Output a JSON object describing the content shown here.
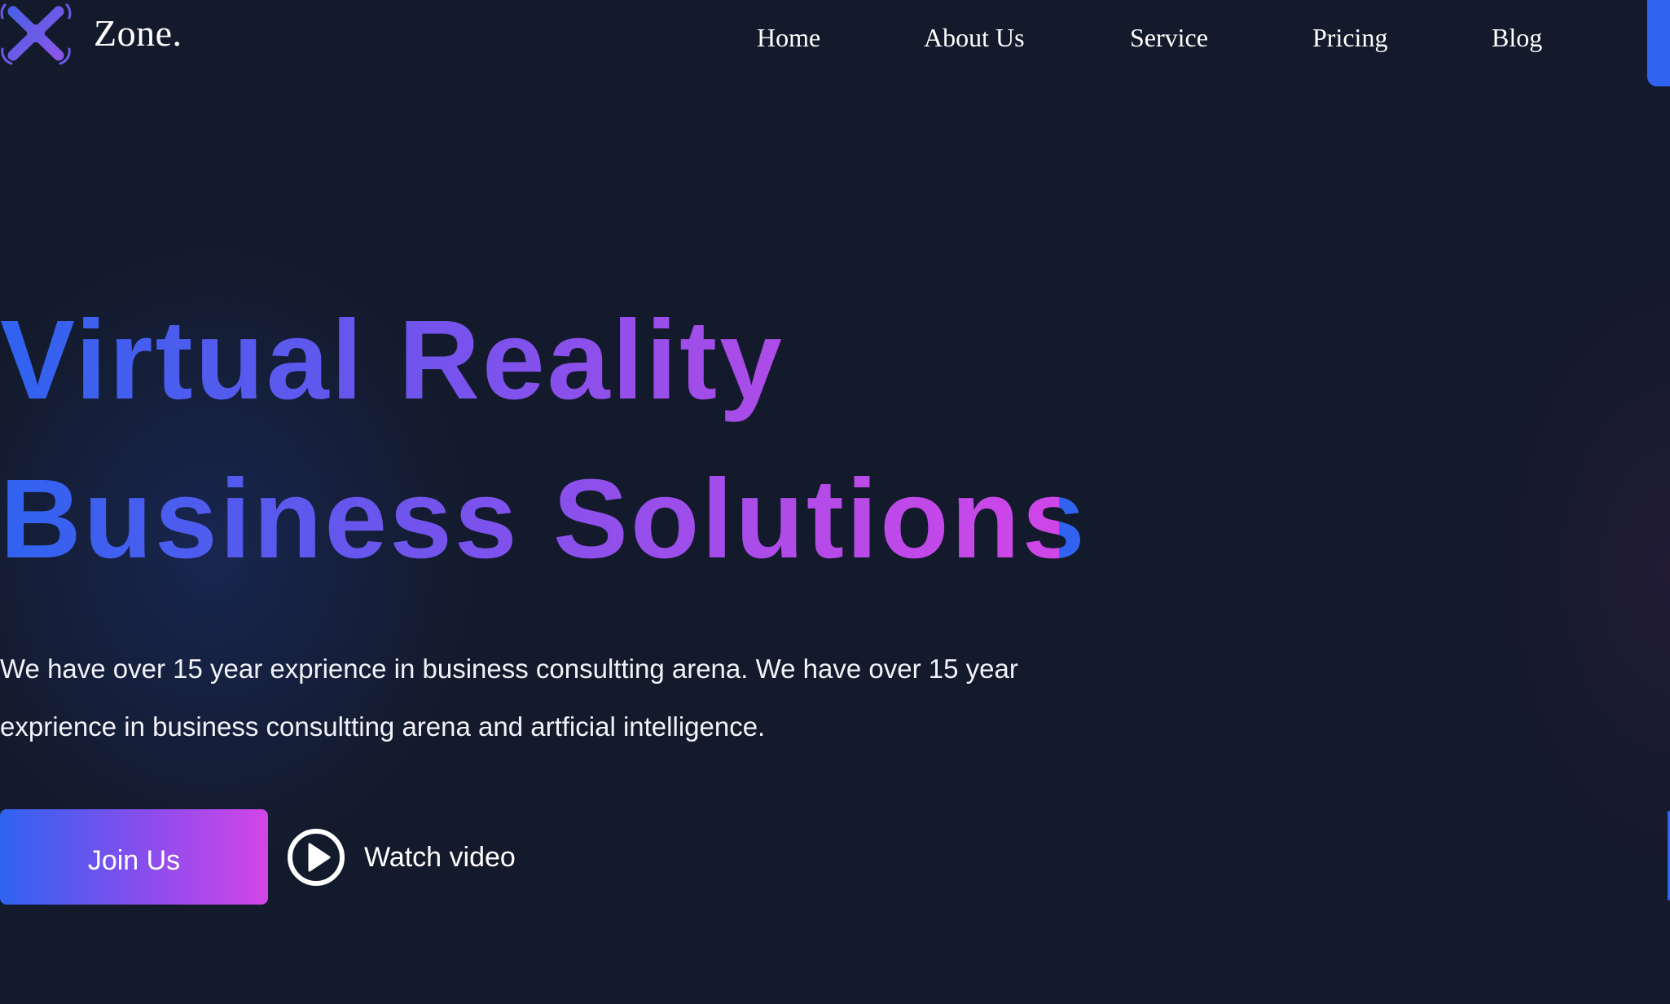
{
  "brand": {
    "name": "Zone.",
    "logo_icon": "drone-icon"
  },
  "nav": {
    "items": [
      {
        "label": "Home"
      },
      {
        "label": "About Us"
      },
      {
        "label": "Service"
      },
      {
        "label": "Pricing"
      },
      {
        "label": "Blog"
      }
    ]
  },
  "hero": {
    "headline_line1": "Virtual Reality",
    "headline_line2": "Business Solutions",
    "description": "We have over 15 year exprience in business consultting arena. We have over 15 year exprience in business consultting arena and artficial intelligence.",
    "join_label": "Join Us",
    "watch_label": "Watch video",
    "watch_icon": "play-circle-icon"
  },
  "colors": {
    "background": "#131a2b",
    "accent_blue": "#2f63f0",
    "accent_purple": "#8a4ded",
    "accent_magenta": "#d345e8",
    "text": "#ffffff"
  }
}
